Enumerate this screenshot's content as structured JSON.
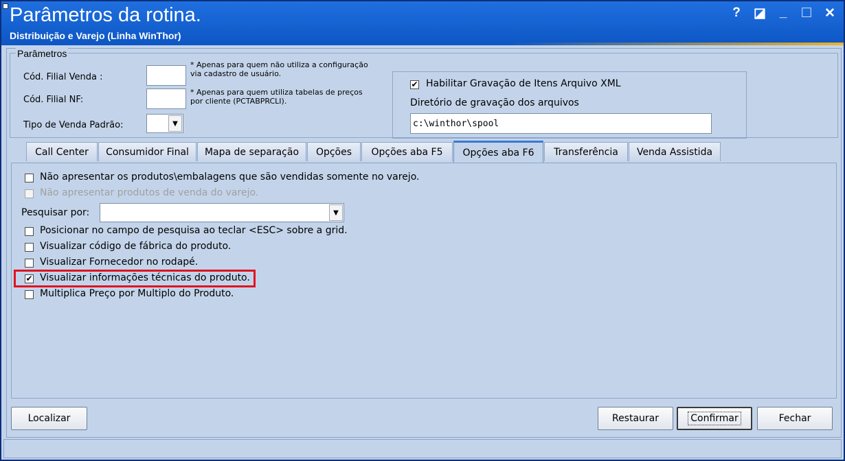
{
  "window": {
    "title": "Parâmetros da rotina.",
    "subtitle": "Distribuição e Varejo (Linha WinThor)",
    "help_glyph": "?",
    "restore_glyph": "◪",
    "minimize_glyph": "_",
    "maximize_glyph": "☐",
    "close_glyph": "✕"
  },
  "parametros": {
    "legend": "Parâmetros",
    "filial_venda_label": "Cód. Filial Venda :",
    "filial_venda_value": "",
    "filial_venda_note": "* Apenas para quem não utiliza a configuração via cadastro de usuário.",
    "filial_nf_label": "Cód. Filial NF:",
    "filial_nf_value": "",
    "filial_nf_note": "* Apenas para quem utiliza tabelas de preços por cliente (PCTABPRCLI).",
    "tipo_venda_label": "Tipo de Venda Padrão:",
    "tipo_venda_value": ""
  },
  "xml": {
    "habilitar_label": "Habilitar Gravação de Itens Arquivo XML",
    "habilitar_checked": true,
    "diretorio_label": "Diretório de gravação dos arquivos",
    "diretorio_value": "c:\\winthor\\spool"
  },
  "tabs": [
    {
      "label": "Call Center",
      "active": false
    },
    {
      "label": "Consumidor Final",
      "active": false
    },
    {
      "label": "Mapa de separação",
      "active": false
    },
    {
      "label": "Opções",
      "active": false
    },
    {
      "label": "Opções aba F5",
      "active": false
    },
    {
      "label": "Opções aba F6",
      "active": true
    },
    {
      "label": "Transferência",
      "active": false
    },
    {
      "label": "Venda Assistida",
      "active": false
    }
  ],
  "options": [
    {
      "label": "Não apresentar os produtos\\embalagens que são vendidas somente no varejo.",
      "checked": false,
      "disabled": false
    },
    {
      "label": "Não apresentar produtos de venda do varejo.",
      "checked": false,
      "disabled": true
    }
  ],
  "pesquisar": {
    "label": "Pesquisar por:",
    "value": ""
  },
  "options2": [
    {
      "label": "Posicionar no campo de pesquisa ao teclar <ESC> sobre a grid.",
      "checked": false
    },
    {
      "label": "Visualizar código de fábrica do produto.",
      "checked": false
    },
    {
      "label": "Visualizar Fornecedor no rodapé.",
      "checked": false
    },
    {
      "label": "Visualizar informações técnicas do produto.",
      "checked": true,
      "highlighted": true
    },
    {
      "label": "Multiplica Preço por Multiplo do Produto.",
      "checked": false
    }
  ],
  "buttons": {
    "localizar": "Localizar",
    "restaurar": "Restaurar",
    "confirmar": "Confirmar",
    "fechar": "Fechar"
  },
  "check_glyph": "✔",
  "combo_arrow": "▼",
  "colors": {
    "title_bar": "#0d56c4",
    "window_bg": "#c3d4ea",
    "highlight_border": "#e0141e",
    "active_tab_accent": "#3a78d4"
  }
}
